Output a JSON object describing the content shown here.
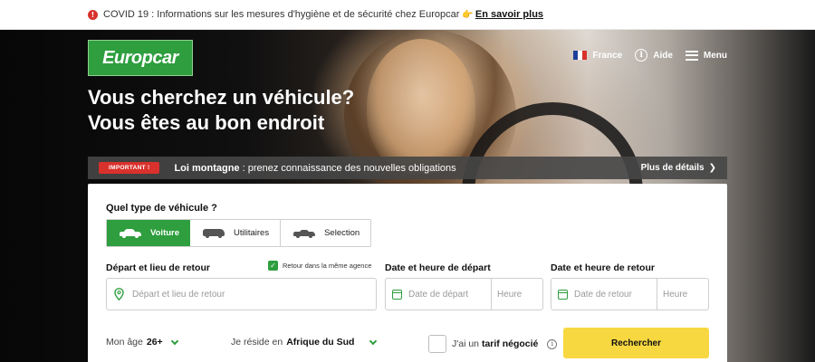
{
  "notice": {
    "info_icon": "!",
    "text": "COVID 19 : Informations sur les mesures d'hygiène et de sécurité chez Europcar",
    "hand_icon": "👉",
    "link": "En savoir plus"
  },
  "brand": {
    "logo": "Europcar",
    "green": "#2e9e3e",
    "yellow": "#f7d841",
    "red": "#d9312c"
  },
  "topnav": {
    "country": "France",
    "help": "Aide",
    "menu": "Menu",
    "help_icon": "i"
  },
  "hero": {
    "line1": "Vous cherchez un véhicule?",
    "line2": "Vous êtes au bon endroit"
  },
  "alert": {
    "badge": "IMPORTANT !",
    "title": "Loi montagne",
    "text": " : prenez connaissance des nouvelles obligations",
    "details": "Plus de détails",
    "details_icon": "❯"
  },
  "booking": {
    "vehicle_question": "Quel type de véhicule ?",
    "vehicle_types": [
      {
        "label": "Voiture",
        "active": true
      },
      {
        "label": "Utilitaires",
        "active": false
      },
      {
        "label": "Selection",
        "active": false
      }
    ],
    "pickup_label": "Départ et lieu de retour",
    "same_return": "Retour dans la même agence",
    "same_return_checked": true,
    "check_mark": "✓",
    "pickup_placeholder": "Départ et lieu de retour",
    "departure_label": "Date et heure de départ",
    "departure_date_placeholder": "Date de départ",
    "departure_time_placeholder": "Heure",
    "return_label": "Date et heure de retour",
    "return_date_placeholder": "Date de retour",
    "return_time_placeholder": "Heure",
    "age_label": "Mon âge",
    "age_value": "26+",
    "residence_label": "Je réside en",
    "residence_value": "Afrique du Sud",
    "tarif_prefix": "J'ai un ",
    "tarif_bold": "tarif négocié",
    "tarif_info_icon": "i",
    "search_button": "Rechercher"
  }
}
